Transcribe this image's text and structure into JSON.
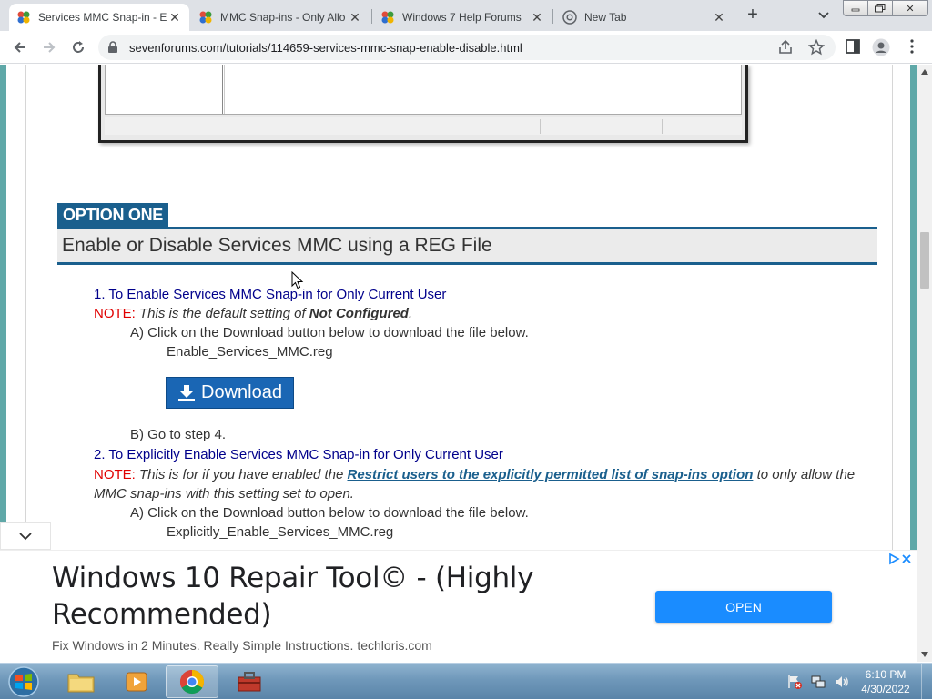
{
  "browser": {
    "tabs": [
      {
        "title": "Services MMC Snap-in - E",
        "active": true
      },
      {
        "title": "MMC Snap-ins - Only Allo",
        "active": false
      },
      {
        "title": "Windows 7 Help Forums",
        "active": false
      },
      {
        "title": "New Tab",
        "active": false
      }
    ],
    "url": "sevenforums.com/tutorials/114659-services-mmc-snap-enable-disable.html"
  },
  "page": {
    "option_label": "OPTION ONE",
    "option_heading": "Enable or Disable Services MMC using a REG File",
    "step1": {
      "num": "1.",
      "title": "To Enable Services MMC Snap-in for Only Current User",
      "note_label": "NOTE:",
      "note_text": "This is the default setting of",
      "note_bold": "Not Configured",
      "note_end": ".",
      "a_text": "A) Click on the Download button below to download the file below.",
      "filename": "Enable_Services_MMC.reg",
      "download_label": "Download",
      "b_text": "B) Go to step 4."
    },
    "step2": {
      "num": "2.",
      "title": "To Explicitly Enable Services MMC Snap-in for Only Current User",
      "note_label": "NOTE:",
      "note_text": "This is for if you have enabled the",
      "note_link": "Restrict users to the explicitly permitted list of snap-ins option",
      "note_text2": "to only allow the",
      "note_line2": "MMC snap-ins with this setting set to open.",
      "a_text": "A) Click on the Download button below to download the file below.",
      "filename": "Explicitly_Enable_Services_MMC.reg"
    }
  },
  "ad": {
    "title": "Windows 10 Repair Tool© - (Highly Recommended)",
    "description": "Fix Windows in 2 Minutes. Really Simple Instructions. techloris.com",
    "open_label": "OPEN"
  },
  "taskbar": {
    "time": "6:10 PM",
    "date": "4/30/2022"
  },
  "colors": {
    "accent_blue": "#1a5f8d",
    "step_blue": "#00008b",
    "note_red": "#e00000",
    "download_blue": "#1a66b4",
    "ad_button": "#1a8cff",
    "side_teal": "#5fa8a8"
  }
}
